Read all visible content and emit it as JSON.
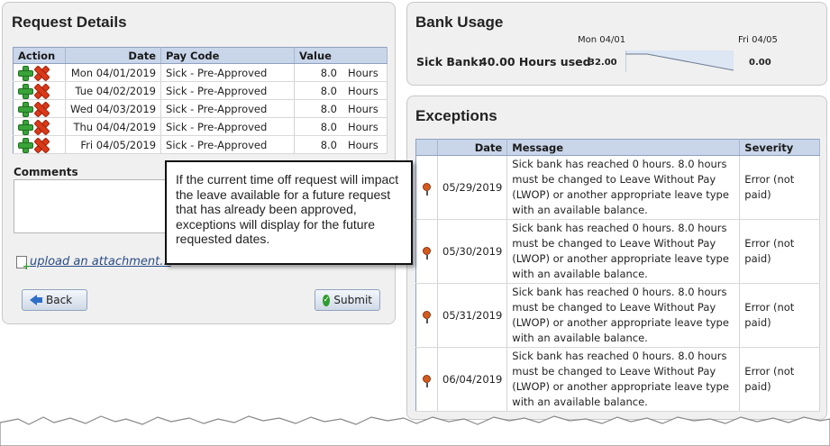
{
  "request": {
    "title": "Request Details",
    "columns": {
      "action": "Action",
      "date": "Date",
      "pay_code": "Pay Code",
      "value": "Value"
    },
    "rows": [
      {
        "date": "Mon 04/01/2019",
        "pay_code": "Sick - Pre-Approved",
        "value": "8.0",
        "unit": "Hours"
      },
      {
        "date": "Tue 04/02/2019",
        "pay_code": "Sick - Pre-Approved",
        "value": "8.0",
        "unit": "Hours"
      },
      {
        "date": "Wed 04/03/2019",
        "pay_code": "Sick - Pre-Approved",
        "value": "8.0",
        "unit": "Hours"
      },
      {
        "date": "Thu 04/04/2019",
        "pay_code": "Sick - Pre-Approved",
        "value": "8.0",
        "unit": "Hours"
      },
      {
        "date": "Fri 04/05/2019",
        "pay_code": "Sick - Pre-Approved",
        "value": "8.0",
        "unit": "Hours"
      }
    ],
    "comments_label": "Comments",
    "comments_value": "",
    "upload_link": "upload an attachment...",
    "back_label": "Back",
    "submit_label": "Submit"
  },
  "bank_usage": {
    "title": "Bank Usage",
    "start_date": "Mon 04/01",
    "end_date": "Fri 04/05",
    "label": "Sick Bank:",
    "value": "40.00 Hours used",
    "start_value": "32.00",
    "end_value": "0.00"
  },
  "exceptions": {
    "title": "Exceptions",
    "columns": {
      "date": "Date",
      "message": "Message",
      "severity": "Severity"
    },
    "rows": [
      {
        "date": "05/29/2019",
        "message": "Sick bank has reached 0 hours. 8.0 hours must be changed to Leave Without Pay (LWOP) or another appropriate leave type with an available balance.",
        "severity": "Error (not paid)"
      },
      {
        "date": "05/30/2019",
        "message": "Sick bank has reached 0 hours. 8.0 hours must be changed to Leave Without Pay (LWOP) or another appropriate leave type with an available balance.",
        "severity": "Error (not paid)"
      },
      {
        "date": "05/31/2019",
        "message": "Sick bank has reached 0 hours. 8.0 hours must be changed to Leave Without Pay (LWOP) or another appropriate leave type with an available balance.",
        "severity": "Error (not paid)"
      },
      {
        "date": "06/04/2019",
        "message": "Sick bank has reached 0 hours. 8.0 hours must be changed to Leave Without Pay (LWOP) or another appropriate leave type with an available balance.",
        "severity": "Error (not paid)"
      }
    ]
  },
  "callout_text": "If the current time off request will impact the leave available for a future request that has already been approved, exceptions will display for the future requested dates."
}
